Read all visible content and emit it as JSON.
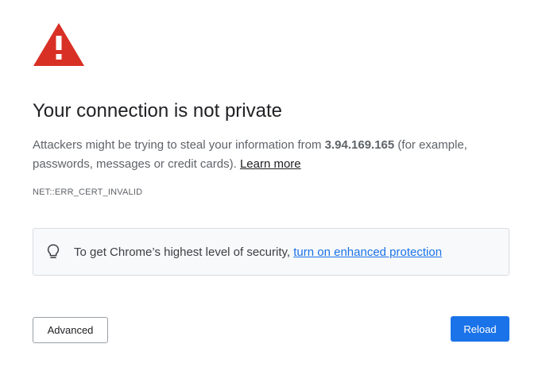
{
  "interstitial": {
    "heading": "Your connection is not private",
    "message_prefix": "Attackers might be trying to steal your information from ",
    "host": "3.94.169.165",
    "message_suffix": " (for example, passwords, messages or credit cards). ",
    "learn_more_label": "Learn more",
    "error_code": "NET::ERR_CERT_INVALID"
  },
  "enhanced_protection": {
    "text": "To get Chrome’s highest level of security, ",
    "link_label": "turn on enhanced protection",
    "icon": "lightbulb-icon"
  },
  "buttons": {
    "advanced_label": "Advanced",
    "reload_label": "Reload"
  },
  "colors": {
    "warning_red": "#d93025",
    "link_blue": "#1a73e8",
    "primary_button": "#1a73e8"
  },
  "icons": {
    "warning": "warning-triangle-icon"
  }
}
